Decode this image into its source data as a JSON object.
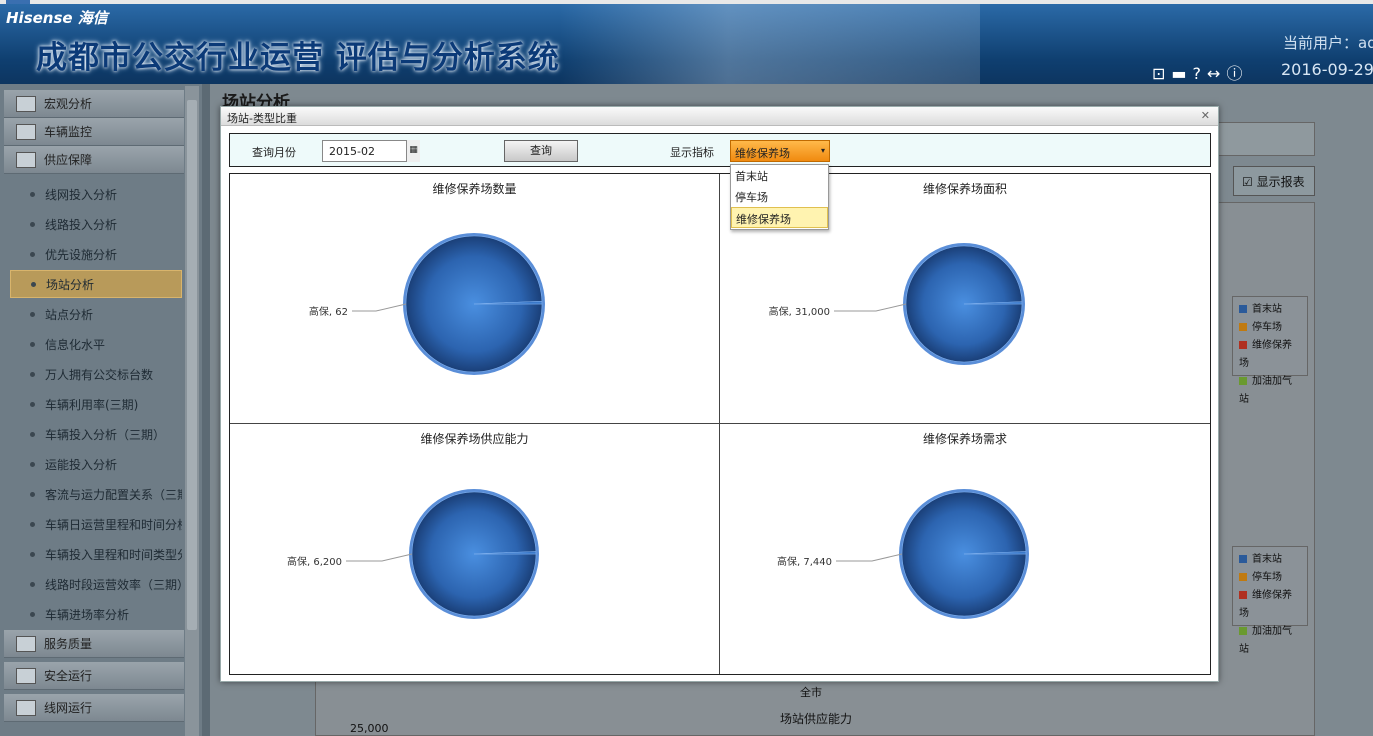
{
  "header": {
    "brand": "Hisense 海信",
    "system_title": "成都市公交行业运营 评估与分析系统",
    "current_user": "当前用户：ad",
    "date": "2016-09-29"
  },
  "sidebar": {
    "groups_top": [
      {
        "label": "宏观分析",
        "icon": "trend-icon"
      },
      {
        "label": "车辆监控",
        "icon": "monitor-icon"
      },
      {
        "label": "供应保障",
        "icon": "supply-icon"
      }
    ],
    "items": [
      {
        "label": "线网投入分析"
      },
      {
        "label": "线路投入分析"
      },
      {
        "label": "优先设施分析"
      },
      {
        "label": "场站分析",
        "active": true
      },
      {
        "label": "站点分析"
      },
      {
        "label": "信息化水平"
      },
      {
        "label": "万人拥有公交标台数"
      },
      {
        "label": "车辆利用率(三期)"
      },
      {
        "label": "车辆投入分析（三期）"
      },
      {
        "label": "运能投入分析"
      },
      {
        "label": "客流与运力配置关系（三期）"
      },
      {
        "label": "车辆日运营里程和时间分析"
      },
      {
        "label": "车辆投入里程和时间类型分析"
      },
      {
        "label": "线路时段运营效率（三期）"
      },
      {
        "label": "车辆进场率分析"
      }
    ],
    "groups_bottom": [
      {
        "label": "服务质量",
        "icon": "quality-icon"
      },
      {
        "label": "安全运行",
        "icon": "safety-icon"
      },
      {
        "label": "线网运行",
        "icon": "network-icon"
      }
    ]
  },
  "main": {
    "page_title": "场站分析",
    "show_report": "显示报表",
    "legend": [
      "首末站",
      "停车场",
      "维修保养场",
      "加油加气站"
    ],
    "legend_colors": [
      "#2a5a9a",
      "#c07a10",
      "#b03020",
      "#6a9a30"
    ],
    "city_label": "全市",
    "chart2_title": "场站供应能力",
    "axis_tick": "25,000"
  },
  "modal": {
    "title": "场站-类型比重",
    "close_icon": "close-icon",
    "month_label": "查询月份",
    "month_value": "2015-02",
    "query_button": "查询",
    "indicator_label": "显示指标",
    "indicator_value": "维修保养场",
    "dropdown_options": [
      "首末站",
      "停车场",
      "维修保养场"
    ],
    "selected_option": "维修保养场"
  },
  "chart_data": [
    {
      "type": "pie",
      "title": "维修保养场数量",
      "categories": [
        "高保",
        ""
      ],
      "values": [
        62,
        0.4
      ],
      "data_labels": [
        "高保, 62"
      ]
    },
    {
      "type": "pie",
      "title": "维修保养场面积",
      "categories": [
        "高保",
        ""
      ],
      "values": [
        31000,
        200
      ],
      "data_labels": [
        "高保, 31,000"
      ]
    },
    {
      "type": "pie",
      "title": "维修保养场供应能力",
      "categories": [
        "高保",
        ""
      ],
      "values": [
        6200,
        40
      ],
      "data_labels": [
        "高保, 6,200"
      ]
    },
    {
      "type": "pie",
      "title": "维修保养场需求",
      "categories": [
        "高保",
        ""
      ],
      "values": [
        7440,
        48
      ],
      "data_labels": [
        "高保, 7,440"
      ]
    }
  ]
}
